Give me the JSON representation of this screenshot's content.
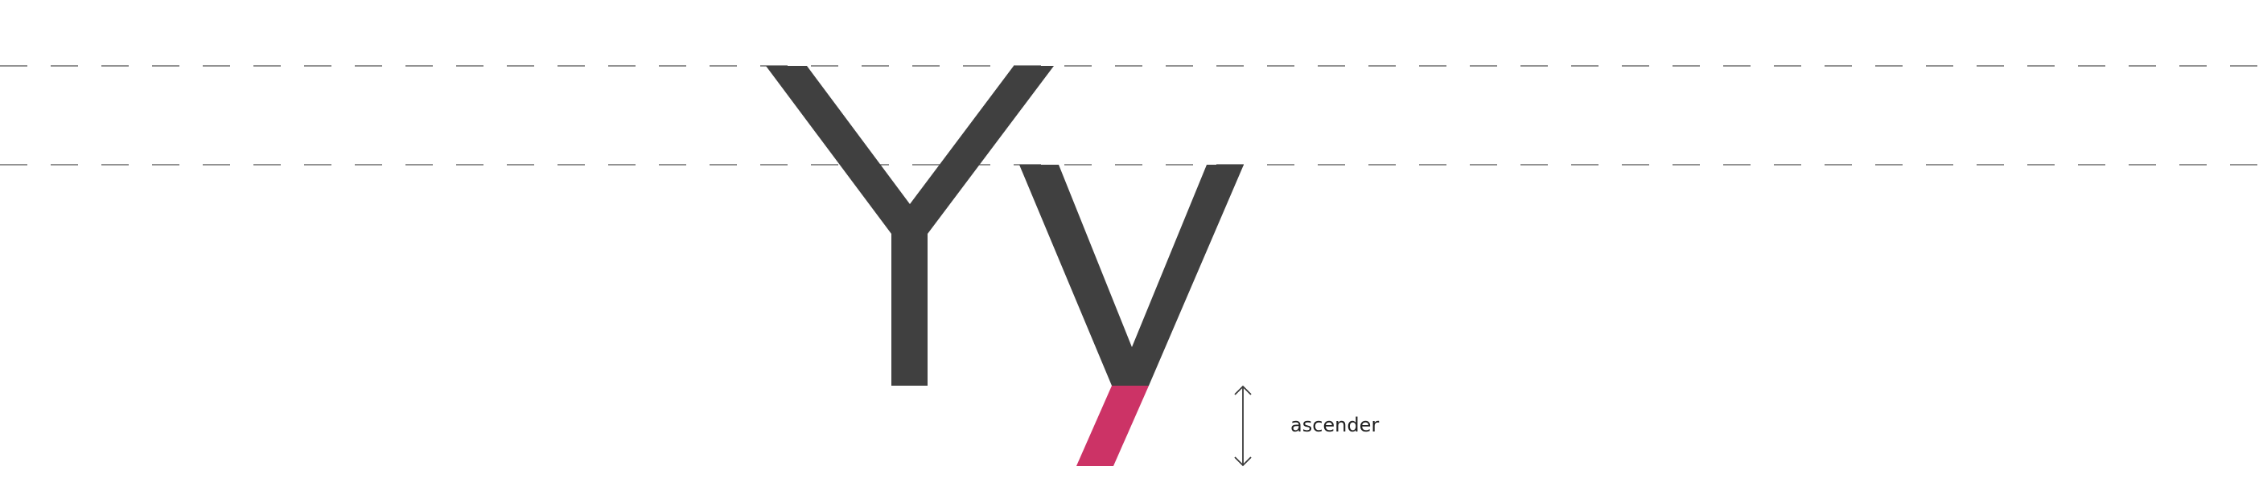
{
  "diagram": {
    "annotation_label": "ascender",
    "glyphs": [
      "Y",
      "y"
    ],
    "colors": {
      "glyph": "#404040",
      "accent": "#cc3366",
      "guide": "#6f6f6f",
      "background": "#ffffff"
    },
    "icons": [
      "double-headed-vertical-arrow"
    ]
  }
}
